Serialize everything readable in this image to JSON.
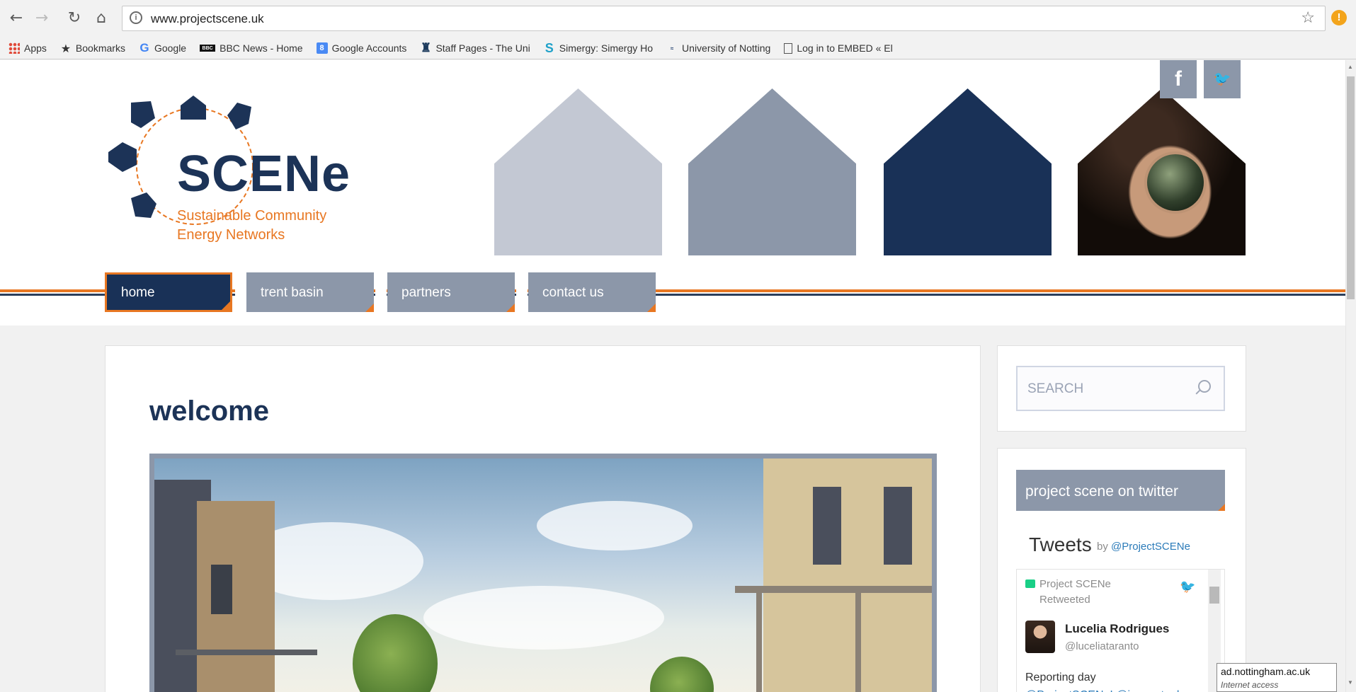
{
  "browser": {
    "url": "www.projectscene.uk",
    "bookmarks": [
      {
        "label": "Apps",
        "icon": "apps-icon"
      },
      {
        "label": "Bookmarks",
        "icon": "star-icon"
      },
      {
        "label": "Google",
        "icon": "google-icon"
      },
      {
        "label": "BBC News - Home",
        "icon": "bbc-icon"
      },
      {
        "label": "Google Accounts",
        "icon": "google-accounts-icon"
      },
      {
        "label": "Staff Pages - The Uni",
        "icon": "staff-icon"
      },
      {
        "label": "Simergy: Simergy Ho",
        "icon": "simergy-icon"
      },
      {
        "label": "University of Notting",
        "icon": "uon-icon"
      },
      {
        "label": "Log in to EMBED « El",
        "icon": "page-icon"
      }
    ]
  },
  "site": {
    "logo_title": "SCENe",
    "logo_sub_1": "Sustainable Community",
    "logo_sub_2": "Energy Networks",
    "nav": [
      "home",
      "trent basin",
      "partners",
      "contact us"
    ],
    "active_nav": "home",
    "social": {
      "facebook": "f",
      "twitter": "🐦"
    }
  },
  "main": {
    "heading": "welcome"
  },
  "sidebar": {
    "search_placeholder": "SEARCH",
    "twitter_heading": "project scene on twitter",
    "tweets_title": "Tweets",
    "tweets_by": "by",
    "tweets_handle": "@ProjectSCENe",
    "retweet_label": "Project SCENe Retweeted",
    "tweet_author": "Lucelia Rodrigues",
    "tweet_handle": "@luceliataranto",
    "tweet_text": "Reporting day",
    "tweet_mentions": "@ProjectSCENe! @innovateuk"
  },
  "status_tooltip": {
    "host": "ad.nottingham.ac.uk",
    "note": "Internet access"
  },
  "colors": {
    "navy": "#193157",
    "slate": "#8c97a9",
    "light_slate": "#c3c8d3",
    "orange": "#e87722"
  }
}
